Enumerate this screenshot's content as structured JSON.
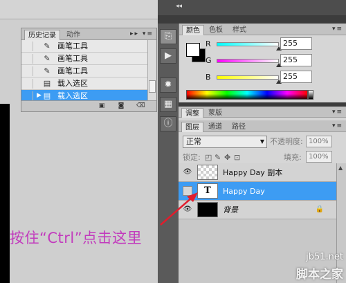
{
  "history_panel": {
    "tabs": [
      "历史记录",
      "动作"
    ],
    "items": [
      {
        "label": "画笔工具",
        "icon": "brush-icon"
      },
      {
        "label": "画笔工具",
        "icon": "brush-icon"
      },
      {
        "label": "画笔工具",
        "icon": "brush-icon"
      },
      {
        "label": "载入选区",
        "icon": "document-icon"
      },
      {
        "label": "载入选区",
        "icon": "document-icon",
        "selected": true
      }
    ]
  },
  "color_panel": {
    "tabs": [
      "颜色",
      "色板",
      "样式"
    ],
    "channels": [
      {
        "name": "R",
        "value": "255"
      },
      {
        "name": "G",
        "value": "255"
      },
      {
        "name": "B",
        "value": "255"
      }
    ],
    "foreground": "#ffffff",
    "background": "#000000"
  },
  "adjust_tabs": [
    "调整",
    "蒙版"
  ],
  "layers_panel": {
    "tabs": [
      "图层",
      "通道",
      "路径"
    ],
    "blend_mode": "正常",
    "opacity_label": "不透明度:",
    "opacity_value": "100%",
    "lock_label": "锁定:",
    "fill_label": "填充:",
    "fill_value": "100%",
    "layers": [
      {
        "name": "Happy Day 副本",
        "thumb": "checker",
        "visible": true
      },
      {
        "name": "Happy Day",
        "thumb": "text",
        "thumb_text": "T",
        "visible": false,
        "selected": true
      },
      {
        "name": "背景",
        "thumb": "black",
        "visible": true,
        "locked": true
      }
    ]
  },
  "annotation": {
    "text": "按住“Ctrl”点击这里",
    "color": "#c23bbd"
  },
  "watermark": {
    "site": "jb51.net",
    "name": "脚本之家"
  },
  "accent_color": "#3d9cf3"
}
